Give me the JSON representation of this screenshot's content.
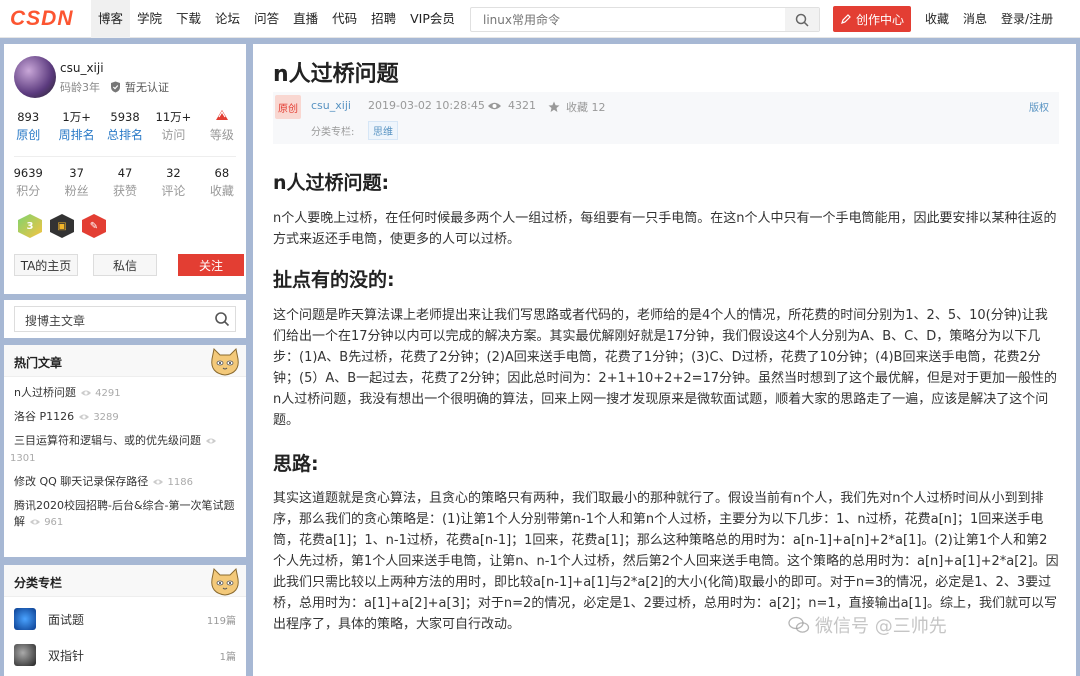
{
  "nav": {
    "logo": "CSDN",
    "links": [
      "博客",
      "学院",
      "下载",
      "论坛",
      "问答",
      "直播",
      "代码",
      "招聘",
      "VIP会员"
    ],
    "search_placeholder": "linux常用命令",
    "create_label": "创作中心",
    "right_links": [
      "收藏",
      "消息",
      "登录/注册"
    ]
  },
  "profile": {
    "username": "csu_xiji",
    "code_age": "码龄3年",
    "certification": "暂无认证",
    "stats_row1": [
      {
        "num": "893",
        "label": "原创"
      },
      {
        "num": "1万+",
        "label": "周排名"
      },
      {
        "num": "5938",
        "label": "总排名"
      },
      {
        "num": "11万+",
        "label": "访问"
      },
      {
        "num": "",
        "label": "等级"
      }
    ],
    "stats_row2": [
      {
        "num": "9639",
        "label": "积分"
      },
      {
        "num": "37",
        "label": "粉丝"
      },
      {
        "num": "47",
        "label": "获赞"
      },
      {
        "num": "32",
        "label": "评论"
      },
      {
        "num": "68",
        "label": "收藏"
      }
    ],
    "buttons": {
      "home": "TA的主页",
      "message": "私信",
      "follow": "关注"
    }
  },
  "sidebar_search": {
    "placeholder": "搜博主文章"
  },
  "hot_articles": {
    "title": "热门文章",
    "items": [
      {
        "title": "n人过桥问题",
        "views": "4291"
      },
      {
        "title": "洛谷 P1126",
        "views": "3289"
      },
      {
        "title": "三目运算符和逻辑与、或的优先级问题",
        "views": "1301"
      },
      {
        "title": "修改 QQ 聊天记录保存路径",
        "views": "1186"
      },
      {
        "title": "腾讯2020校园招聘-后台&综合-第一次笔试题解",
        "views": "961"
      }
    ]
  },
  "columns": {
    "title": "分类专栏",
    "items": [
      {
        "name": "面试题",
        "count": "119篇"
      },
      {
        "name": "双指针",
        "count": "1篇"
      }
    ]
  },
  "article": {
    "title": "n人过桥问题",
    "original_tag": "原创",
    "author": "csu_xiji",
    "date": "2019-03-02 10:28:45",
    "views": "4321",
    "favorites": "收藏 12",
    "copyright": "版权",
    "category_label": "分类专栏:",
    "category_tag": "思维",
    "sections": [
      {
        "heading": "n人过桥问题:",
        "text": "n个人要晚上过桥，在任何时候最多两个人一组过桥，每组要有一只手电筒。在这n个人中只有一个手电筒能用，因此要安排以某种往返的方式来返还手电筒，使更多的人可以过桥。"
      },
      {
        "heading": "扯点有的没的:",
        "text": "这个问题是昨天算法课上老师提出来让我们写思路或者代码的，老师给的是4个人的情况，所花费的时间分别为1、2、5、10(分钟)让我们给出一个在17分钟以内可以完成的解决方案。其实最优解刚好就是17分钟，我们假设这4个人分别为A、B、C、D，策略分为以下几步：(1)A、B先过桥，花费了2分钟；(2)A回来送手电筒，花费了1分钟；(3)C、D过桥，花费了10分钟；(4)B回来送手电筒，花费2分钟；(5）A、B一起过去，花费了2分钟；因此总时间为：2+1+10+2+2=17分钟。虽然当时想到了这个最优解，但是对于更加一般性的n人过桥问题，我没有想出一个很明确的算法，回来上网一搜才发现原来是微软面试题，顺着大家的思路走了一遍，应该是解决了这个问题。"
      },
      {
        "heading": "思路:",
        "text": "其实这道题就是贪心算法，且贪心的策略只有两种，我们取最小的那种就行了。假设当前有n个人，我们先对n个人过桥时间从小到到排序，那么我们的贪心策略是：(1)让第1个人分别带第n-1个人和第n个人过桥，主要分为以下几步：1、n过桥，花费a[n]；1回来送手电筒，花费a[1]；1、n-1过桥，花费a[n-1]；1回来，花费a[1]；那么这种策略总的用时为：a[n-1]+a[n]+2*a[1]。(2)让第1个人和第2个人先过桥，第1个人回来送手电筒，让第n、n-1个人过桥，然后第2个人回来送手电筒。这个策略的总用时为：a[n]+a[1]+2*a[2]。因此我们只需比较以上两种方法的用时，即比较a[n-1]+a[1]与2*a[2]的大小(化简)取最小的即可。对于n=3的情况，必定是1、2、3要过桥，总用时为：a[1]+a[2]+a[3]；对于n=2的情况，必定是1、2要过桥，总用时为：a[2]；n=1，直接输出a[1]。综上，我们就可以写出程序了，具体的策略，大家可自行改动。"
      }
    ]
  },
  "watermark": "微信号 @三帅先"
}
